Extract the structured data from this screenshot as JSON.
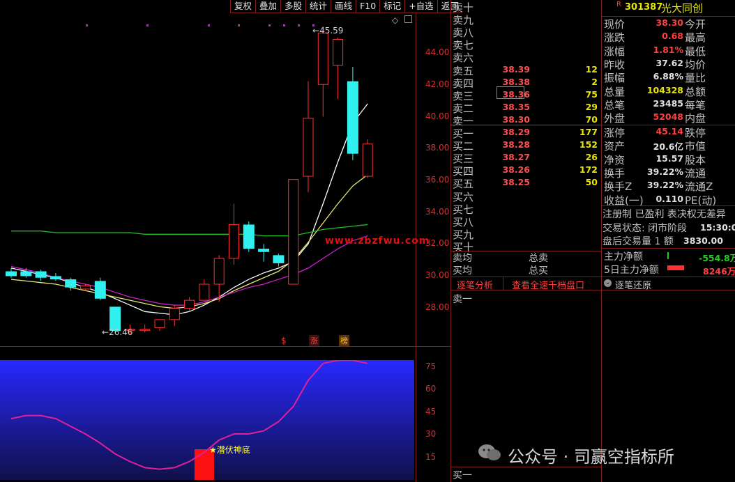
{
  "toolbar": {
    "items": [
      "复权",
      "叠加",
      "多股",
      "统计",
      "画线",
      "F10",
      "标记",
      "+自选",
      "返回"
    ]
  },
  "main_chart": {
    "y_ticks": [
      "44.00",
      "42.00",
      "40.00",
      "38.00",
      "36.00",
      "34.00",
      "32.00",
      "30.00",
      "28.00"
    ],
    "high_label": "45.59",
    "low_label": "26.46",
    "watermark_url": "www.zbzfwu.com",
    "markers": [
      "$",
      "涨",
      "榜"
    ],
    "diamond": "◇",
    "marker_note": "·"
  },
  "chart_data": [
    {
      "type": "candlestick",
      "title": "",
      "ylim": [
        26.5,
        46.5
      ],
      "candles": [
        {
          "o": 30.4,
          "h": 30.6,
          "l": 30.0,
          "c": 30.1
        },
        {
          "o": 30.4,
          "h": 30.6,
          "l": 30.0,
          "c": 30.1
        },
        {
          "o": 30.4,
          "h": 30.5,
          "l": 29.8,
          "c": 30.0
        },
        {
          "o": 30.1,
          "h": 30.3,
          "l": 29.8,
          "c": 29.9
        },
        {
          "o": 29.9,
          "h": 30.0,
          "l": 29.2,
          "c": 29.4
        },
        {
          "o": 29.3,
          "h": 29.6,
          "l": 29.2,
          "c": 29.5
        },
        {
          "o": 29.8,
          "h": 30.0,
          "l": 28.6,
          "c": 28.7
        },
        {
          "o": 28.2,
          "h": 28.2,
          "l": 26.7,
          "c": 26.7
        },
        {
          "o": 26.8,
          "h": 27.1,
          "l": 26.5,
          "c": 26.8
        },
        {
          "o": 26.8,
          "h": 27.1,
          "l": 26.6,
          "c": 26.8
        },
        {
          "o": 26.9,
          "h": 27.4,
          "l": 26.7,
          "c": 27.4
        },
        {
          "o": 27.4,
          "h": 28.3,
          "l": 27.0,
          "c": 28.1
        },
        {
          "o": 28.1,
          "h": 28.8,
          "l": 27.9,
          "c": 28.6
        },
        {
          "o": 28.6,
          "h": 29.9,
          "l": 28.5,
          "c": 29.6
        },
        {
          "o": 29.6,
          "h": 31.4,
          "l": 28.5,
          "c": 31.2
        },
        {
          "o": 31.2,
          "h": 34.6,
          "l": 30.8,
          "c": 33.3
        },
        {
          "o": 33.3,
          "h": 33.5,
          "l": 31.6,
          "c": 31.8
        },
        {
          "o": 31.8,
          "h": 32.1,
          "l": 31.0,
          "c": 31.6
        },
        {
          "o": 31.4,
          "h": 31.5,
          "l": 30.7,
          "c": 30.9
        },
        {
          "o": 29.6,
          "h": 36.1,
          "l": 29.6,
          "c": 36.1
        },
        {
          "o": 36.3,
          "h": 42.2,
          "l": 35.3,
          "c": 39.9
        },
        {
          "o": 42.0,
          "h": 45.6,
          "l": 40.0,
          "c": 45.2
        },
        {
          "o": 43.2,
          "h": 44.9,
          "l": 41.1,
          "c": 44.8
        },
        {
          "o": 42.2,
          "h": 43.1,
          "l": 37.3,
          "c": 37.7
        },
        {
          "o": 36.3,
          "h": 38.6,
          "l": 36.2,
          "c": 38.3
        }
      ],
      "ma_series": [
        {
          "values": [
            30.6,
            30.4,
            30.2,
            30.0,
            29.7,
            29.4,
            29.1,
            28.7,
            28.3,
            27.9,
            27.8,
            27.7,
            27.9,
            28.3,
            28.8,
            29.4,
            29.9,
            30.3,
            30.6,
            31.0,
            32.1,
            34.6,
            37.2,
            39.6,
            40.8
          ],
          "color": "#ffffff"
        },
        {
          "values": [
            29.9,
            29.8,
            29.7,
            29.6,
            29.4,
            29.2,
            29.0,
            28.8,
            28.6,
            28.4,
            28.2,
            28.1,
            28.2,
            28.4,
            28.7,
            29.2,
            29.6,
            30.0,
            30.4,
            31.1,
            32.2,
            33.4,
            34.6,
            35.7,
            36.4
          ],
          "color": "#e8e870"
        },
        {
          "values": [
            30.7,
            30.5,
            30.3,
            30.0,
            29.8,
            29.6,
            29.4,
            29.1,
            28.8,
            28.6,
            28.4,
            28.3,
            28.3,
            28.5,
            28.8,
            29.1,
            29.4,
            29.6,
            29.9,
            30.2,
            30.6,
            31.2,
            31.8,
            32.3,
            32.6
          ],
          "color": "#d020d0"
        },
        {
          "values": [
            32.9,
            32.9,
            32.9,
            32.8,
            32.8,
            32.8,
            32.8,
            32.8,
            32.8,
            32.7,
            32.7,
            32.7,
            32.7,
            32.7,
            32.7,
            32.7,
            32.7,
            32.6,
            32.6,
            32.6,
            32.8,
            33.0,
            33.1,
            33.2,
            33.3
          ],
          "color": "#20c020"
        }
      ]
    },
    {
      "type": "line",
      "title": "",
      "ylim": [
        1,
        79
      ],
      "y_ticks": [
        75,
        60,
        45,
        30,
        15
      ],
      "series": [
        {
          "values": [
            40,
            42,
            42,
            40,
            35,
            30,
            24,
            17,
            12,
            8,
            7,
            8,
            12,
            18,
            26,
            30,
            30,
            32,
            38,
            48,
            65,
            76,
            78,
            78,
            76
          ],
          "color": "#e0209a"
        }
      ],
      "bar_signal": {
        "index": 13,
        "value": 20,
        "label": "★潜伏神底"
      }
    }
  ],
  "orderbook": {
    "asks": [
      {
        "label": "卖十",
        "price": "",
        "vol": ""
      },
      {
        "label": "卖九",
        "price": "",
        "vol": ""
      },
      {
        "label": "卖八",
        "price": "",
        "vol": ""
      },
      {
        "label": "卖七",
        "price": "",
        "vol": ""
      },
      {
        "label": "卖六",
        "price": "",
        "vol": ""
      },
      {
        "label": "卖五",
        "price": "38.39",
        "vol": "12"
      },
      {
        "label": "卖四",
        "price": "38.38",
        "vol": "2"
      },
      {
        "label": "卖三",
        "price": "38.36",
        "vol": "75"
      },
      {
        "label": "卖二",
        "price": "38.35",
        "vol": "29"
      },
      {
        "label": "卖一",
        "price": "38.30",
        "vol": "70"
      }
    ],
    "bids": [
      {
        "label": "买一",
        "price": "38.29",
        "vol": "177"
      },
      {
        "label": "买二",
        "price": "38.28",
        "vol": "152"
      },
      {
        "label": "买三",
        "price": "38.27",
        "vol": "26"
      },
      {
        "label": "买四",
        "price": "38.26",
        "vol": "172"
      },
      {
        "label": "买五",
        "price": "38.25",
        "vol": "50"
      },
      {
        "label": "买六",
        "price": "",
        "vol": ""
      },
      {
        "label": "买七",
        "price": "",
        "vol": ""
      },
      {
        "label": "买八",
        "price": "",
        "vol": ""
      },
      {
        "label": "买九",
        "price": "",
        "vol": ""
      },
      {
        "label": "买十",
        "price": "",
        "vol": ""
      }
    ],
    "sell_avg": "卖均",
    "total_sell": "总卖",
    "buy_avg": "买均",
    "total_buy": "总买",
    "tick_tab": "逐笔分析",
    "full_depth_link": "查看全速千档盘口",
    "tick_first": "卖一",
    "bottom_first": "买一"
  },
  "quote": {
    "badge": "R",
    "code": "301387",
    "name": "光大同创",
    "rows": [
      {
        "l1": "现价",
        "v": "38.30",
        "c": "red",
        "l2": "今开"
      },
      {
        "l1": "涨跌",
        "v": "0.68",
        "c": "red",
        "l2": "最高"
      },
      {
        "l1": "涨幅",
        "v": "1.81%",
        "c": "red",
        "l2": "最低"
      },
      {
        "l1": "昨收",
        "v": "37.62",
        "c": "wht",
        "l2": "均价"
      },
      {
        "l1": "振幅",
        "v": "6.88%",
        "c": "wht",
        "l2": "量比"
      },
      {
        "l1": "总量",
        "v": "104328",
        "c": "yel",
        "l2": "总额"
      },
      {
        "l1": "总笔",
        "v": "23485",
        "c": "wht",
        "l2": "每笔"
      },
      {
        "l1": "外盘",
        "v": "52048",
        "c": "red",
        "l2": "内盘"
      }
    ],
    "rows2": [
      {
        "l1": "涨停",
        "v": "45.14",
        "c": "red",
        "l2": "跌停"
      },
      {
        "l1": "资产",
        "v": "20.6亿",
        "c": "wht",
        "l2": "市值"
      },
      {
        "l1": "净资",
        "v": "15.57",
        "c": "wht",
        "l2": "股本"
      },
      {
        "l1": "换手",
        "v": "39.22%",
        "c": "wht",
        "l2": "流通"
      },
      {
        "l1": "换手Z",
        "v": "39.22%",
        "c": "wht",
        "l2": "流通Z"
      },
      {
        "l1": "收益(一)",
        "v": "0.110",
        "c": "wht",
        "l2": "PE(动)"
      }
    ],
    "reg_line": "注册制 已盈利 表决权无差异",
    "status_label": "交易状态: 闭市阶段",
    "status_time": "15:30:00",
    "after_label": "盘后交易量 1 额",
    "after_amount": "3830.00",
    "main_net_label": "主力净额",
    "main_net_value": "-554.8万",
    "five_day_label": "5日主力净额",
    "five_day_value": "8246万",
    "tick_restore": "逐笔还原"
  },
  "footer_watermark": "公众号 · 司赢空指标所"
}
